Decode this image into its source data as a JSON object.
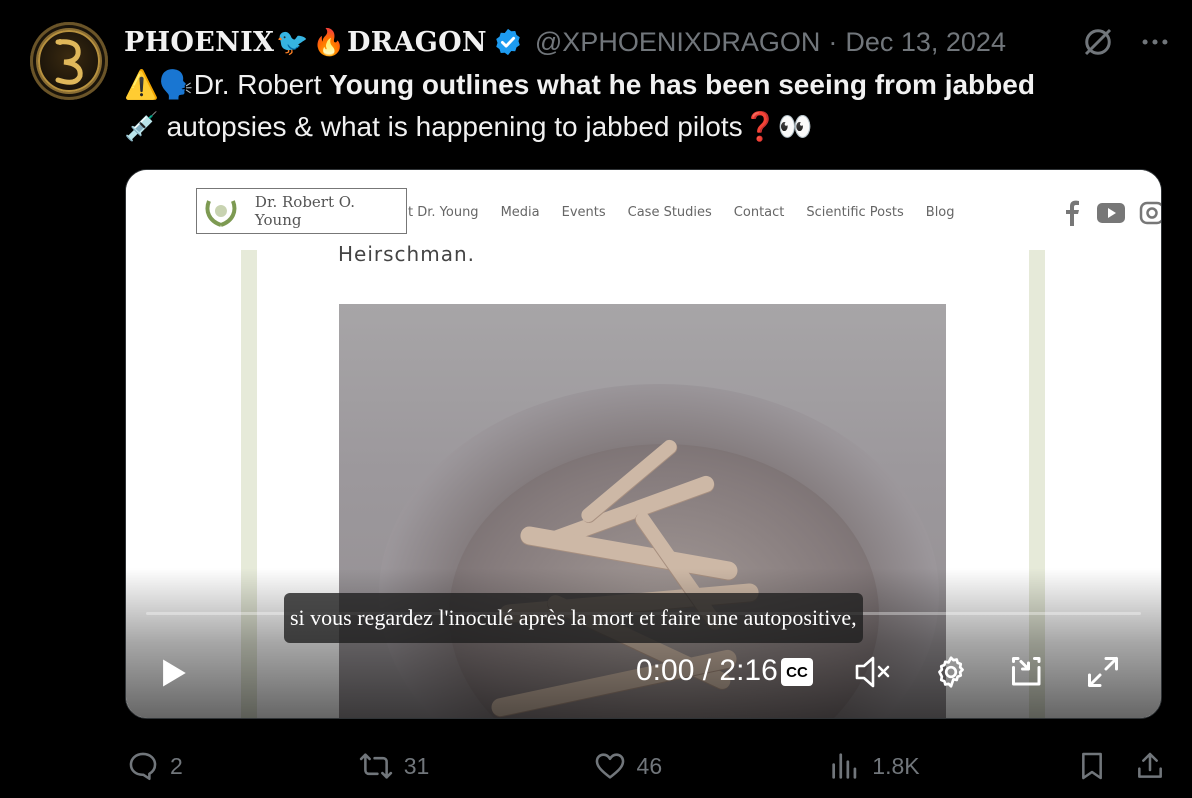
{
  "author": {
    "name_left": "PHOENIX",
    "name_emoji_1": "🐦",
    "name_emoji_2": "🔥",
    "name_right": "DRAGON",
    "handle": "@XPHOENIXDRAGON",
    "separator": "·",
    "date": "Dec 13, 2024"
  },
  "tweet": {
    "warn_emoji": "⚠️",
    "speak_emoji": "🗣️",
    "prefix": "Dr. Robert ",
    "bold": "Young outlines what he has been seeing from jabbed",
    "syringe_emoji": "💉",
    "line2": " autopsies & what is happening to jabbed pilots",
    "question_emoji": "❓",
    "eyes_emoji": "👀"
  },
  "video": {
    "site_logo": "Dr. Robert O. Young",
    "nav": [
      "t Dr. Young",
      "Media",
      "Events",
      "Case Studies",
      "Contact",
      "Scientific Posts",
      "Blog"
    ],
    "cut_text": "Heirschman.",
    "caption": "si vous regardez l'inoculé après la mort et faire une autopositive,",
    "time": "0:00 / 2:16",
    "progress": 0,
    "cc_label": "CC"
  },
  "actions": {
    "replies": "2",
    "reposts": "31",
    "likes": "46",
    "views": "1.8K"
  },
  "colors": {
    "background": "#000000",
    "muted": "#71767b",
    "verified": "#1d9bf0",
    "text": "#e7e9ea"
  },
  "icons": [
    "verified-badge-icon",
    "grok-icon",
    "more-icon",
    "play-icon",
    "cc-icon",
    "mute-icon",
    "settings-icon",
    "pip-icon",
    "fullscreen-icon",
    "reply-icon",
    "repost-icon",
    "like-icon",
    "views-icon",
    "bookmark-icon",
    "share-icon"
  ]
}
